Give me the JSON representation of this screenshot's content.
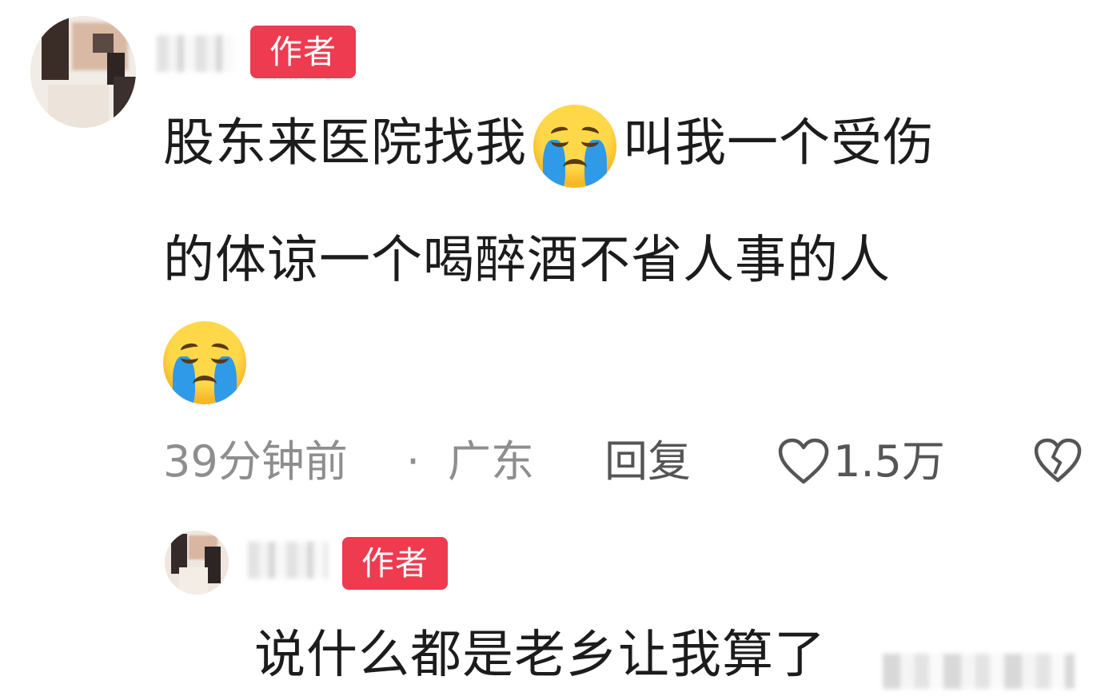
{
  "comment1": {
    "author_badge": "作者",
    "text_line1_a": "股东来医院找我",
    "text_line1_b": "叫我一个受伤",
    "text_line2": "的体谅一个喝醉酒不省人事的人",
    "emoji_name": "loudly-crying-face-icon",
    "time": "39分钟前",
    "separator": "·",
    "location": "广东",
    "reply_label": "回复",
    "like_count": "1.5万"
  },
  "comment2": {
    "author_badge": "作者",
    "text": "说什么都是老乡让我算了"
  },
  "colors": {
    "badge_bg": "#ee3b4f",
    "meta_gray": "#8e8e8e",
    "text_dark": "#1c1c1c"
  }
}
